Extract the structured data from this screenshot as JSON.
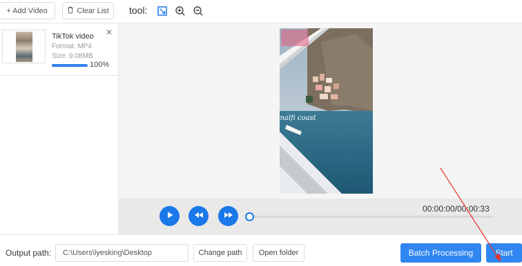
{
  "toolbar": {
    "add_video_label": "+ Add Video",
    "clear_list_label": "Clear List",
    "tool_label": "tool:",
    "icons": [
      "crop-icon",
      "zoom-in-icon",
      "zoom-out-icon"
    ]
  },
  "file_list": {
    "items": [
      {
        "name": "TikTok video",
        "format": "Format:  MP4",
        "size": "Size:  9.08MB",
        "progress_text": "100%",
        "progress": 1.0
      }
    ]
  },
  "video": {
    "overlay_text": "amalfi coast"
  },
  "player": {
    "time": "00:00:00/00:00:33",
    "position": 0.0
  },
  "bottom": {
    "output_label": "Output path:",
    "path_value": "C:\\Users\\lyesking\\Desktop",
    "change_path_label": "Change path",
    "open_folder_label": "Open folder",
    "batch_label": "Batch Processing",
    "start_label": "Start"
  },
  "colors": {
    "accent": "#2f86f0",
    "annotation": "#e8302a"
  }
}
